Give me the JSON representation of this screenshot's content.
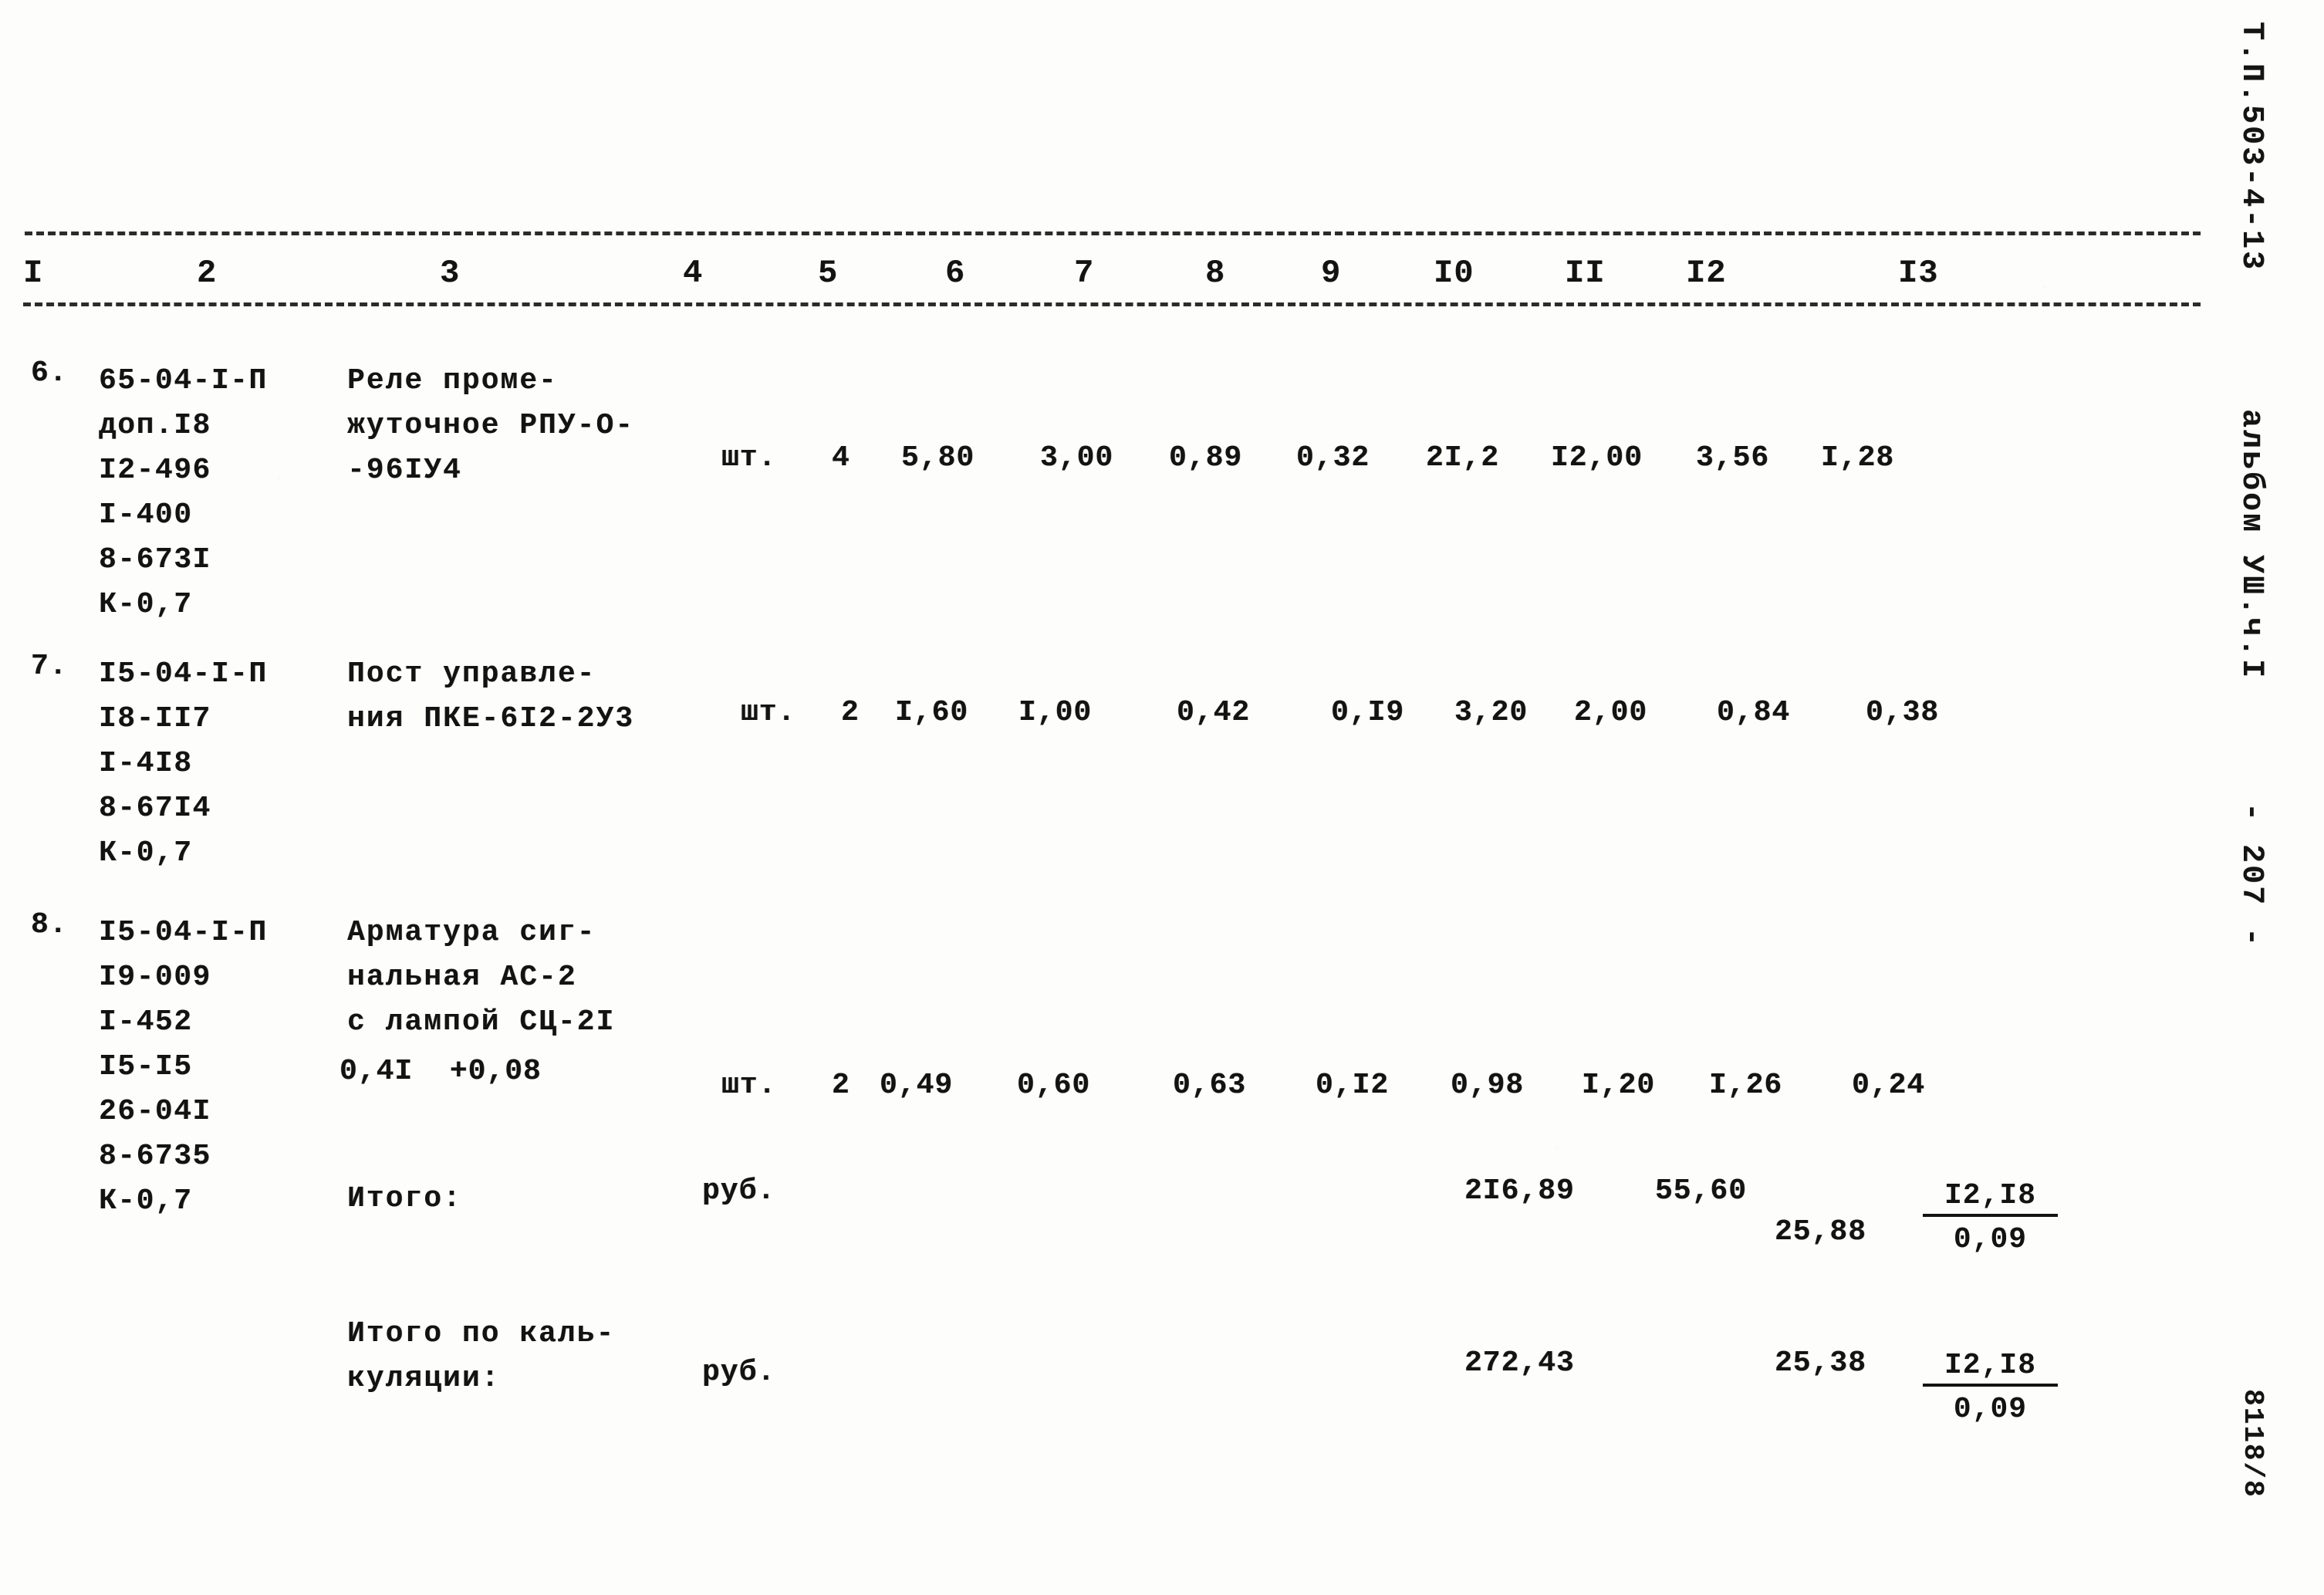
{
  "document": {
    "spec_code": "Т.П.503-4-13",
    "album": "альбом УШ.ч.I",
    "page_marker": "- 207 -",
    "stamp": "8118/8"
  },
  "table": {
    "column_numbers": [
      "I",
      "2",
      "3",
      "4",
      "5",
      "6",
      "7",
      "8",
      "9",
      "I0",
      "II",
      "I2",
      "I3"
    ],
    "rows": [
      {
        "no": "6.",
        "codes": "65-04-I-П\nдоп.I8\nI2-496\nI-400\n8-673I\nК-0,7",
        "name": "Реле проме-\nжуточное РПУ-О-\n-96IУ4",
        "unit": "шт.",
        "qty": "4",
        "c5": "5,80",
        "c6": "3,00",
        "c7": "0,89",
        "c8": "0,32",
        "c9": "2I,2",
        "c10": "I2,00",
        "c11": "3,56",
        "c12": "I,28"
      },
      {
        "no": "7.",
        "codes": "I5-04-I-П\nI8-II7\nI-4I8\n8-67I4\nК-0,7",
        "name": "Пост управле-\nния ПКЕ-6I2-2У3",
        "unit": "шт.",
        "qty": "2",
        "c5": "I,60",
        "c6": "I,00",
        "c7": "0,42",
        "c8": "0,I9",
        "c9": "3,20",
        "c10": "2,00",
        "c11": "0,84",
        "c12": "0,38"
      },
      {
        "no": "8.",
        "codes": "I5-04-I-П\nI9-009\nI-452\nI5-I5\n26-04I\n8-6735\nК-0,7",
        "name": "Арматура сиг-\nнальная АС-2\nс лампой СЦ-2I",
        "correction": "0,4I  +0,08",
        "unit": "шт.",
        "qty": "2",
        "c5": "0,49",
        "c6": "0,60",
        "c7": "0,63",
        "c8": "0,I2",
        "c9": "0,98",
        "c10": "I,20",
        "c11": "I,26",
        "c12": "0,24"
      }
    ],
    "totals": [
      {
        "label": "Итого:",
        "unit": "руб.",
        "c9": "2I6,89",
        "c10": "55,60",
        "c11": "25,88",
        "frac_num": "I2,I8",
        "frac_den": "0,09"
      },
      {
        "label": "Итого по каль-\nкуляции:",
        "unit": "руб.",
        "c9": "272,43",
        "c10": "",
        "c11": "25,38",
        "frac_num": "I2,I8",
        "frac_den": "0,09"
      }
    ]
  }
}
